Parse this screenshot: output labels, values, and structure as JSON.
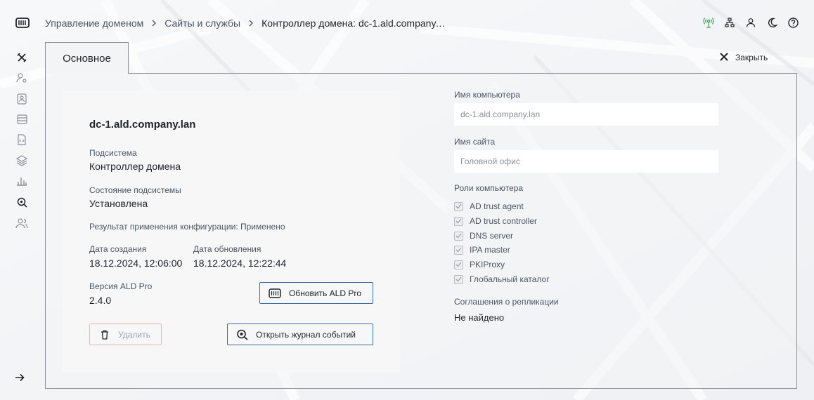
{
  "breadcrumbs": [
    {
      "label": "Управление доменом"
    },
    {
      "label": "Сайты и службы"
    },
    {
      "label": "Контроллер домена: dc-1.ald.company.lan"
    }
  ],
  "tab": {
    "label": "Основное"
  },
  "close": {
    "label": "Закрыть"
  },
  "card": {
    "hostname": "dc-1.ald.company.lan",
    "subsystem_label": "Подсистема",
    "subsystem_value": "Контроллер домена",
    "state_label": "Состояние подсистемы",
    "state_value": "Установлена",
    "config_result": "Результат применения конфигурации: Применено",
    "created_label": "Дата создания",
    "created_value": "18.12.2024, 12:06:00",
    "updated_label": "Дата обновления",
    "updated_value": "18.12.2024, 12:22:44",
    "version_label": "Версия ALD Pro",
    "version_value": "2.4.0",
    "update_button": "Обновить ALD Pro",
    "delete_button": "Удалить",
    "log_button": "Открыть журнал событий"
  },
  "form": {
    "computer_name_label": "Имя компьютера",
    "computer_name_value": "dc-1.ald.company.lan",
    "site_name_label": "Имя сайта",
    "site_name_value": "Головной офис",
    "roles_label": "Роли компьютера",
    "roles": [
      {
        "label": "AD trust agent",
        "checked": true
      },
      {
        "label": "AD trust controller",
        "checked": true
      },
      {
        "label": "DNS server",
        "checked": true
      },
      {
        "label": "IPA master",
        "checked": true
      },
      {
        "label": "PKIProxy",
        "checked": true
      },
      {
        "label": "Глобальный каталог",
        "checked": true
      }
    ],
    "replication_label": "Соглашения о репликации",
    "replication_value": "Не найдено"
  },
  "colors": {
    "accent": "#3d6aa8",
    "status_green": "#3aa34a",
    "danger_border": "#e6b7b7"
  },
  "icons": {
    "top": [
      "antenna-icon",
      "network-icon",
      "user-icon",
      "moon-icon",
      "help-icon"
    ],
    "side": [
      "tools-icon",
      "user-settings-icon",
      "badge-icon",
      "server-icon",
      "code-file-icon",
      "layers-icon",
      "bar-chart-icon",
      "search-icon",
      "users-icon"
    ]
  }
}
